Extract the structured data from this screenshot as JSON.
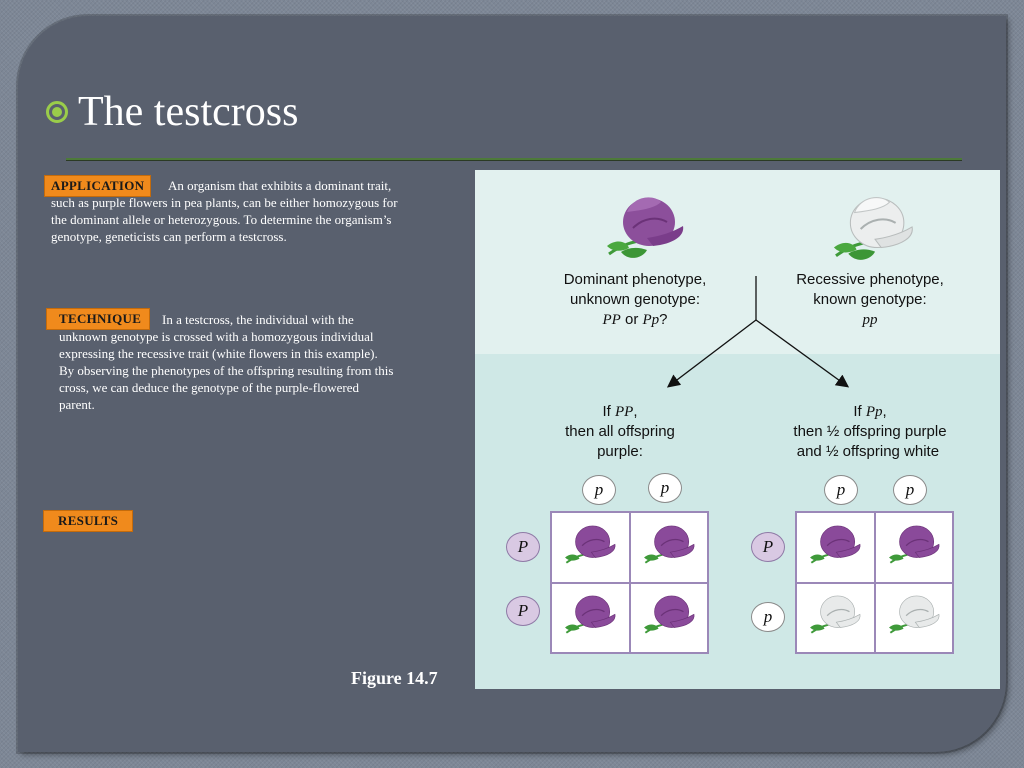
{
  "slide": {
    "title": "The testcross",
    "figure_caption": "Figure 14.7"
  },
  "application": {
    "label": "APPLICATION",
    "line1": "An organism that exhibits a dominant trait,",
    "line2": "such as purple flowers in pea plants, can be either homozygous for",
    "line3": "the dominant allele or heterozygous. To determine the organism’s",
    "line4": "genotype, geneticists can perform a testcross."
  },
  "technique": {
    "label": "TECHNIQUE",
    "line1": "In a testcross, the individual with the",
    "line2": "unknown genotype is crossed with a homozygous individual",
    "line3": "expressing the recessive trait (white flowers in this example).",
    "line4": "By observing the phenotypes of the offspring resulting from this",
    "line5": "cross, we can deduce the genotype of the purple-flowered",
    "line6": "parent."
  },
  "results": {
    "label": "RESULTS"
  },
  "figure": {
    "dominant": {
      "line1": "Dominant phenotype,",
      "line2": "unknown genotype:",
      "g1": "PP",
      "or": " or ",
      "g2": "Pp",
      "q": "?"
    },
    "recessive": {
      "line1": "Recessive phenotype,",
      "line2": "known genotype:",
      "g": "pp"
    },
    "left_case": {
      "if": "If ",
      "g": "PP",
      "comma": ",",
      "line2": "then all offspring",
      "line3": "purple:"
    },
    "right_case": {
      "if": "If ",
      "g": "Pp",
      "comma": ",",
      "line2": "then ½ offspring purple",
      "line3": "and ½ offspring white",
      "colon": ":"
    },
    "left_square": {
      "top": [
        "p",
        "p"
      ],
      "side": [
        "P",
        "P"
      ],
      "cells": [
        "purple",
        "purple",
        "purple",
        "purple"
      ]
    },
    "right_square": {
      "top": [
        "p",
        "p"
      ],
      "side": [
        "P",
        "p"
      ],
      "cells": [
        "purple",
        "purple",
        "white",
        "white"
      ]
    },
    "colors": {
      "purple_flower": "#8a4a9a",
      "white_flower": "#e8eaea",
      "leaf": "#3f9a3a",
      "panel": "#cfe8e6",
      "label": "#f08a1c"
    },
    "icons": [
      "purple-flower-icon",
      "white-flower-icon"
    ]
  }
}
